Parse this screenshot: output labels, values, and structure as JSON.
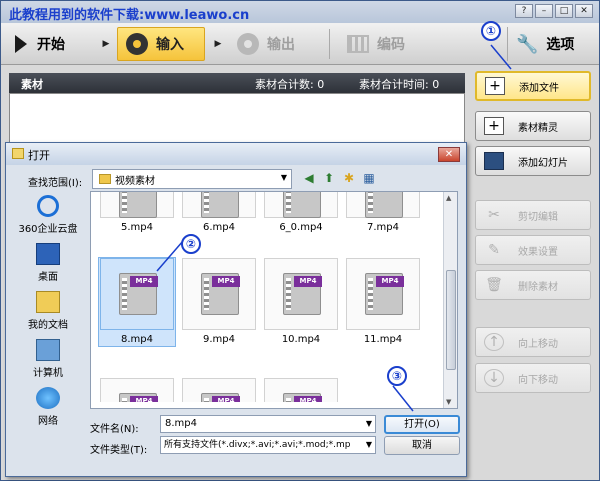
{
  "app": {
    "title": "此教程用到的软件下载:www.leawo.cn",
    "win_buttons": [
      "?",
      "–",
      "□",
      "✕"
    ]
  },
  "toolbar": {
    "start": "开始",
    "input": "输入",
    "output": "输出",
    "encode": "编码",
    "options": "选项"
  },
  "material": {
    "label": "素材",
    "count": "素材合计数: 0",
    "time": "素材合计时间: 0"
  },
  "right_panel": {
    "add_file": "添加文件",
    "material_wizard": "素材精灵",
    "add_slideshow": "添加幻灯片",
    "cut_edit": "剪切编辑",
    "effect_settings": "效果设置",
    "delete_material": "删除素材",
    "move_up": "向上移动",
    "move_down": "向下移动"
  },
  "dialog": {
    "title": "打开",
    "close": "✕",
    "look_in_label": "查找范围(I):",
    "look_in_value": "视频素材",
    "places": [
      "360企业云盘",
      "桌面",
      "我的文档",
      "计算机",
      "网络"
    ],
    "files_top": [
      "5.mp4",
      "6.mp4",
      "6_0.mp4",
      "7.mp4"
    ],
    "files_middle": [
      "8.mp4",
      "9.mp4",
      "10.mp4",
      "11.mp4"
    ],
    "file_tag": "MP4",
    "file_name_label": "文件名(N):",
    "file_name_value": "8.mp4",
    "file_type_label": "文件类型(T):",
    "file_type_value": "所有支持文件(*.divx;*.avi;*.avi;*.mod;*.mp",
    "open_button": "打开(O)",
    "cancel_button": "取消"
  },
  "annotations": [
    "①",
    "②",
    "③"
  ],
  "colors": {
    "title_text": "#1a3fcc",
    "input_tab": "#f5c33b",
    "header_bar": "#2d3138",
    "selection": "#cfe4fb",
    "mp4_tag": "#7a2f9b"
  }
}
